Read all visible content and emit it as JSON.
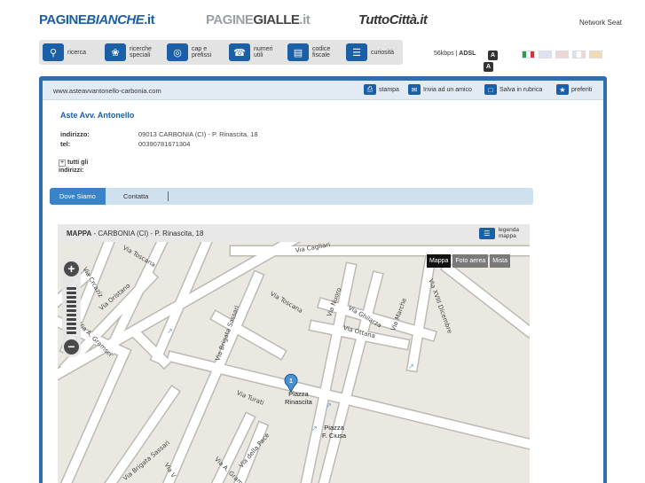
{
  "brands": {
    "paginebianche": {
      "prefix": "PAGINE",
      "highlight": "BIANCHE",
      "suffix": ".it"
    },
    "paginegialle": {
      "prefix": "PAGINE",
      "highlight": "GIALLE",
      "suffix": ".it"
    },
    "tuttocitta": "TuttoCittà.it",
    "network": "Network Seat"
  },
  "services": [
    {
      "label": "ricerca",
      "icon": "search-icon"
    },
    {
      "label": "ricerche\nspeciali",
      "icon": "special-search-icon"
    },
    {
      "label": "cap e\nprefissi",
      "icon": "globe-icon"
    },
    {
      "label": "numeri\nutili",
      "icon": "phone-icon"
    },
    {
      "label": "codice\nfiscale",
      "icon": "id-card-icon"
    },
    {
      "label": "curiosità",
      "icon": "book-icon"
    }
  ],
  "connection": {
    "speed": "56kbps",
    "type": "ADSL",
    "badge": "A"
  },
  "languages": [
    "it",
    "en",
    "de",
    "fr",
    "es"
  ],
  "toolbar": {
    "url": "www.asteavvantonello-carbonia.com",
    "stampa": "stampa",
    "invia": "Invia ad un amico",
    "salva": "Salva in rubrica",
    "preferiti": "preferiti"
  },
  "business": {
    "name": "Aste Avv. Antonello",
    "address_label": "indirizzo:",
    "address": "09013 CARBONIA (CI) - P. Rinascita, 18",
    "tel_label": "tel:",
    "tel": "00390781671304",
    "all_addresses": "tutti gli\nindirizzi:"
  },
  "tabs": {
    "dove": "Dove Siamo",
    "contatta": "Contatta"
  },
  "map": {
    "title": "MAPPA",
    "subtitle": "CARBONIA (CI) - P. Rinascita, 18",
    "legend": "legenda\nmappa",
    "types": [
      "Mappa",
      "Foto aerea",
      "Mista"
    ],
    "zoom_in": "+",
    "zoom_out": "−",
    "marker_number": "1",
    "streets": {
      "toscana_top": "Via Toscana",
      "cagliari": "Via Cagliari",
      "crcaziz": "Via Crcaziz",
      "oristano": "Via Oristano",
      "gramsci": "Via A. Gramsci",
      "toscana_mid": "Via Toscana",
      "nuoro": "Via Nuoro",
      "ghilarza": "Via Ghilarza",
      "marche": "Via Marche",
      "ottana": "Via Ottana",
      "xviii": "Via XVIII Dicembre",
      "brigata_sassari_mid": "Via Brigata Sassari",
      "turati": "Via Turati",
      "brigata_sassari_low": "Via Brigata Sassari",
      "della_pace": "Via della Pace",
      "gramsci_low": "Via A. Gramsci",
      "via_v": "Via V"
    },
    "places": {
      "rinascita": "Piazza\nRinascita",
      "ciusa": "Piazza\nF. Ciusa"
    }
  }
}
